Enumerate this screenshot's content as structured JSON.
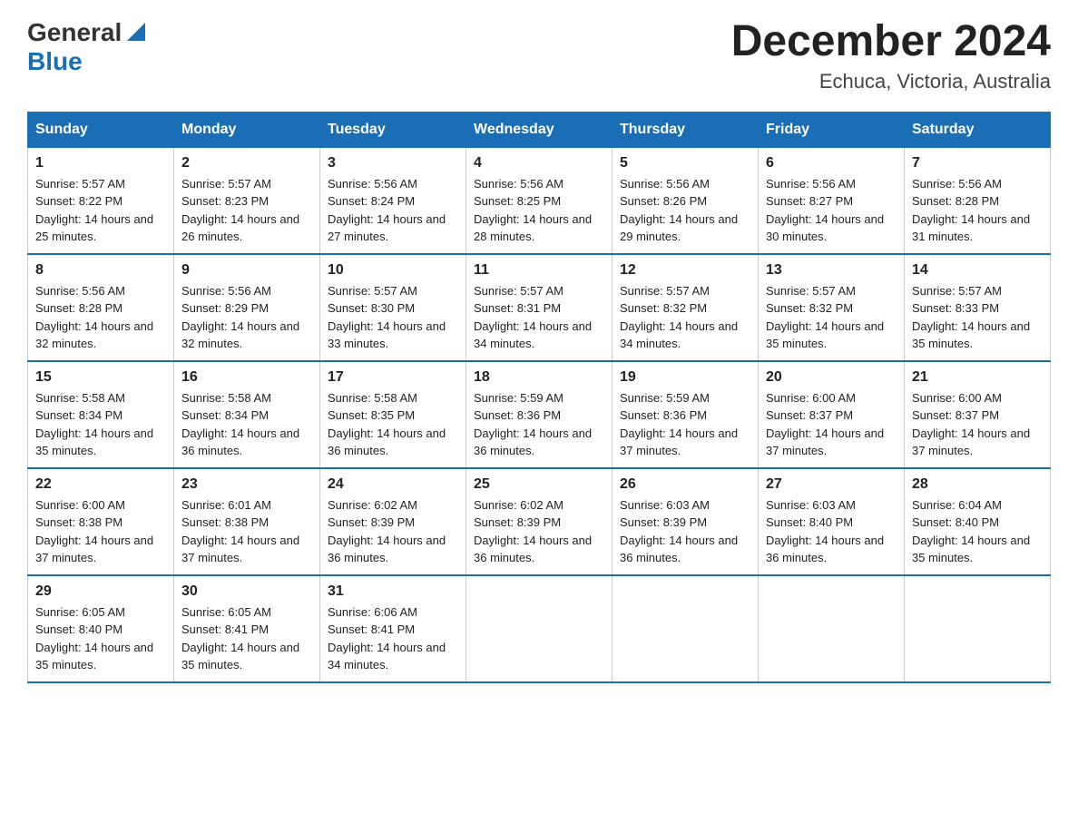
{
  "header": {
    "logo_general": "General",
    "logo_blue": "Blue",
    "month_title": "December 2024",
    "location": "Echuca, Victoria, Australia"
  },
  "columns": [
    "Sunday",
    "Monday",
    "Tuesday",
    "Wednesday",
    "Thursday",
    "Friday",
    "Saturday"
  ],
  "weeks": [
    [
      {
        "day": "1",
        "sunrise": "5:57 AM",
        "sunset": "8:22 PM",
        "daylight": "14 hours and 25 minutes."
      },
      {
        "day": "2",
        "sunrise": "5:57 AM",
        "sunset": "8:23 PM",
        "daylight": "14 hours and 26 minutes."
      },
      {
        "day": "3",
        "sunrise": "5:56 AM",
        "sunset": "8:24 PM",
        "daylight": "14 hours and 27 minutes."
      },
      {
        "day": "4",
        "sunrise": "5:56 AM",
        "sunset": "8:25 PM",
        "daylight": "14 hours and 28 minutes."
      },
      {
        "day": "5",
        "sunrise": "5:56 AM",
        "sunset": "8:26 PM",
        "daylight": "14 hours and 29 minutes."
      },
      {
        "day": "6",
        "sunrise": "5:56 AM",
        "sunset": "8:27 PM",
        "daylight": "14 hours and 30 minutes."
      },
      {
        "day": "7",
        "sunrise": "5:56 AM",
        "sunset": "8:28 PM",
        "daylight": "14 hours and 31 minutes."
      }
    ],
    [
      {
        "day": "8",
        "sunrise": "5:56 AM",
        "sunset": "8:28 PM",
        "daylight": "14 hours and 32 minutes."
      },
      {
        "day": "9",
        "sunrise": "5:56 AM",
        "sunset": "8:29 PM",
        "daylight": "14 hours and 32 minutes."
      },
      {
        "day": "10",
        "sunrise": "5:57 AM",
        "sunset": "8:30 PM",
        "daylight": "14 hours and 33 minutes."
      },
      {
        "day": "11",
        "sunrise": "5:57 AM",
        "sunset": "8:31 PM",
        "daylight": "14 hours and 34 minutes."
      },
      {
        "day": "12",
        "sunrise": "5:57 AM",
        "sunset": "8:32 PM",
        "daylight": "14 hours and 34 minutes."
      },
      {
        "day": "13",
        "sunrise": "5:57 AM",
        "sunset": "8:32 PM",
        "daylight": "14 hours and 35 minutes."
      },
      {
        "day": "14",
        "sunrise": "5:57 AM",
        "sunset": "8:33 PM",
        "daylight": "14 hours and 35 minutes."
      }
    ],
    [
      {
        "day": "15",
        "sunrise": "5:58 AM",
        "sunset": "8:34 PM",
        "daylight": "14 hours and 35 minutes."
      },
      {
        "day": "16",
        "sunrise": "5:58 AM",
        "sunset": "8:34 PM",
        "daylight": "14 hours and 36 minutes."
      },
      {
        "day": "17",
        "sunrise": "5:58 AM",
        "sunset": "8:35 PM",
        "daylight": "14 hours and 36 minutes."
      },
      {
        "day": "18",
        "sunrise": "5:59 AM",
        "sunset": "8:36 PM",
        "daylight": "14 hours and 36 minutes."
      },
      {
        "day": "19",
        "sunrise": "5:59 AM",
        "sunset": "8:36 PM",
        "daylight": "14 hours and 37 minutes."
      },
      {
        "day": "20",
        "sunrise": "6:00 AM",
        "sunset": "8:37 PM",
        "daylight": "14 hours and 37 minutes."
      },
      {
        "day": "21",
        "sunrise": "6:00 AM",
        "sunset": "8:37 PM",
        "daylight": "14 hours and 37 minutes."
      }
    ],
    [
      {
        "day": "22",
        "sunrise": "6:00 AM",
        "sunset": "8:38 PM",
        "daylight": "14 hours and 37 minutes."
      },
      {
        "day": "23",
        "sunrise": "6:01 AM",
        "sunset": "8:38 PM",
        "daylight": "14 hours and 37 minutes."
      },
      {
        "day": "24",
        "sunrise": "6:02 AM",
        "sunset": "8:39 PM",
        "daylight": "14 hours and 36 minutes."
      },
      {
        "day": "25",
        "sunrise": "6:02 AM",
        "sunset": "8:39 PM",
        "daylight": "14 hours and 36 minutes."
      },
      {
        "day": "26",
        "sunrise": "6:03 AM",
        "sunset": "8:39 PM",
        "daylight": "14 hours and 36 minutes."
      },
      {
        "day": "27",
        "sunrise": "6:03 AM",
        "sunset": "8:40 PM",
        "daylight": "14 hours and 36 minutes."
      },
      {
        "day": "28",
        "sunrise": "6:04 AM",
        "sunset": "8:40 PM",
        "daylight": "14 hours and 35 minutes."
      }
    ],
    [
      {
        "day": "29",
        "sunrise": "6:05 AM",
        "sunset": "8:40 PM",
        "daylight": "14 hours and 35 minutes."
      },
      {
        "day": "30",
        "sunrise": "6:05 AM",
        "sunset": "8:41 PM",
        "daylight": "14 hours and 35 minutes."
      },
      {
        "day": "31",
        "sunrise": "6:06 AM",
        "sunset": "8:41 PM",
        "daylight": "14 hours and 34 minutes."
      },
      null,
      null,
      null,
      null
    ]
  ],
  "labels": {
    "sunrise_prefix": "Sunrise: ",
    "sunset_prefix": "Sunset: ",
    "daylight_prefix": "Daylight: "
  }
}
